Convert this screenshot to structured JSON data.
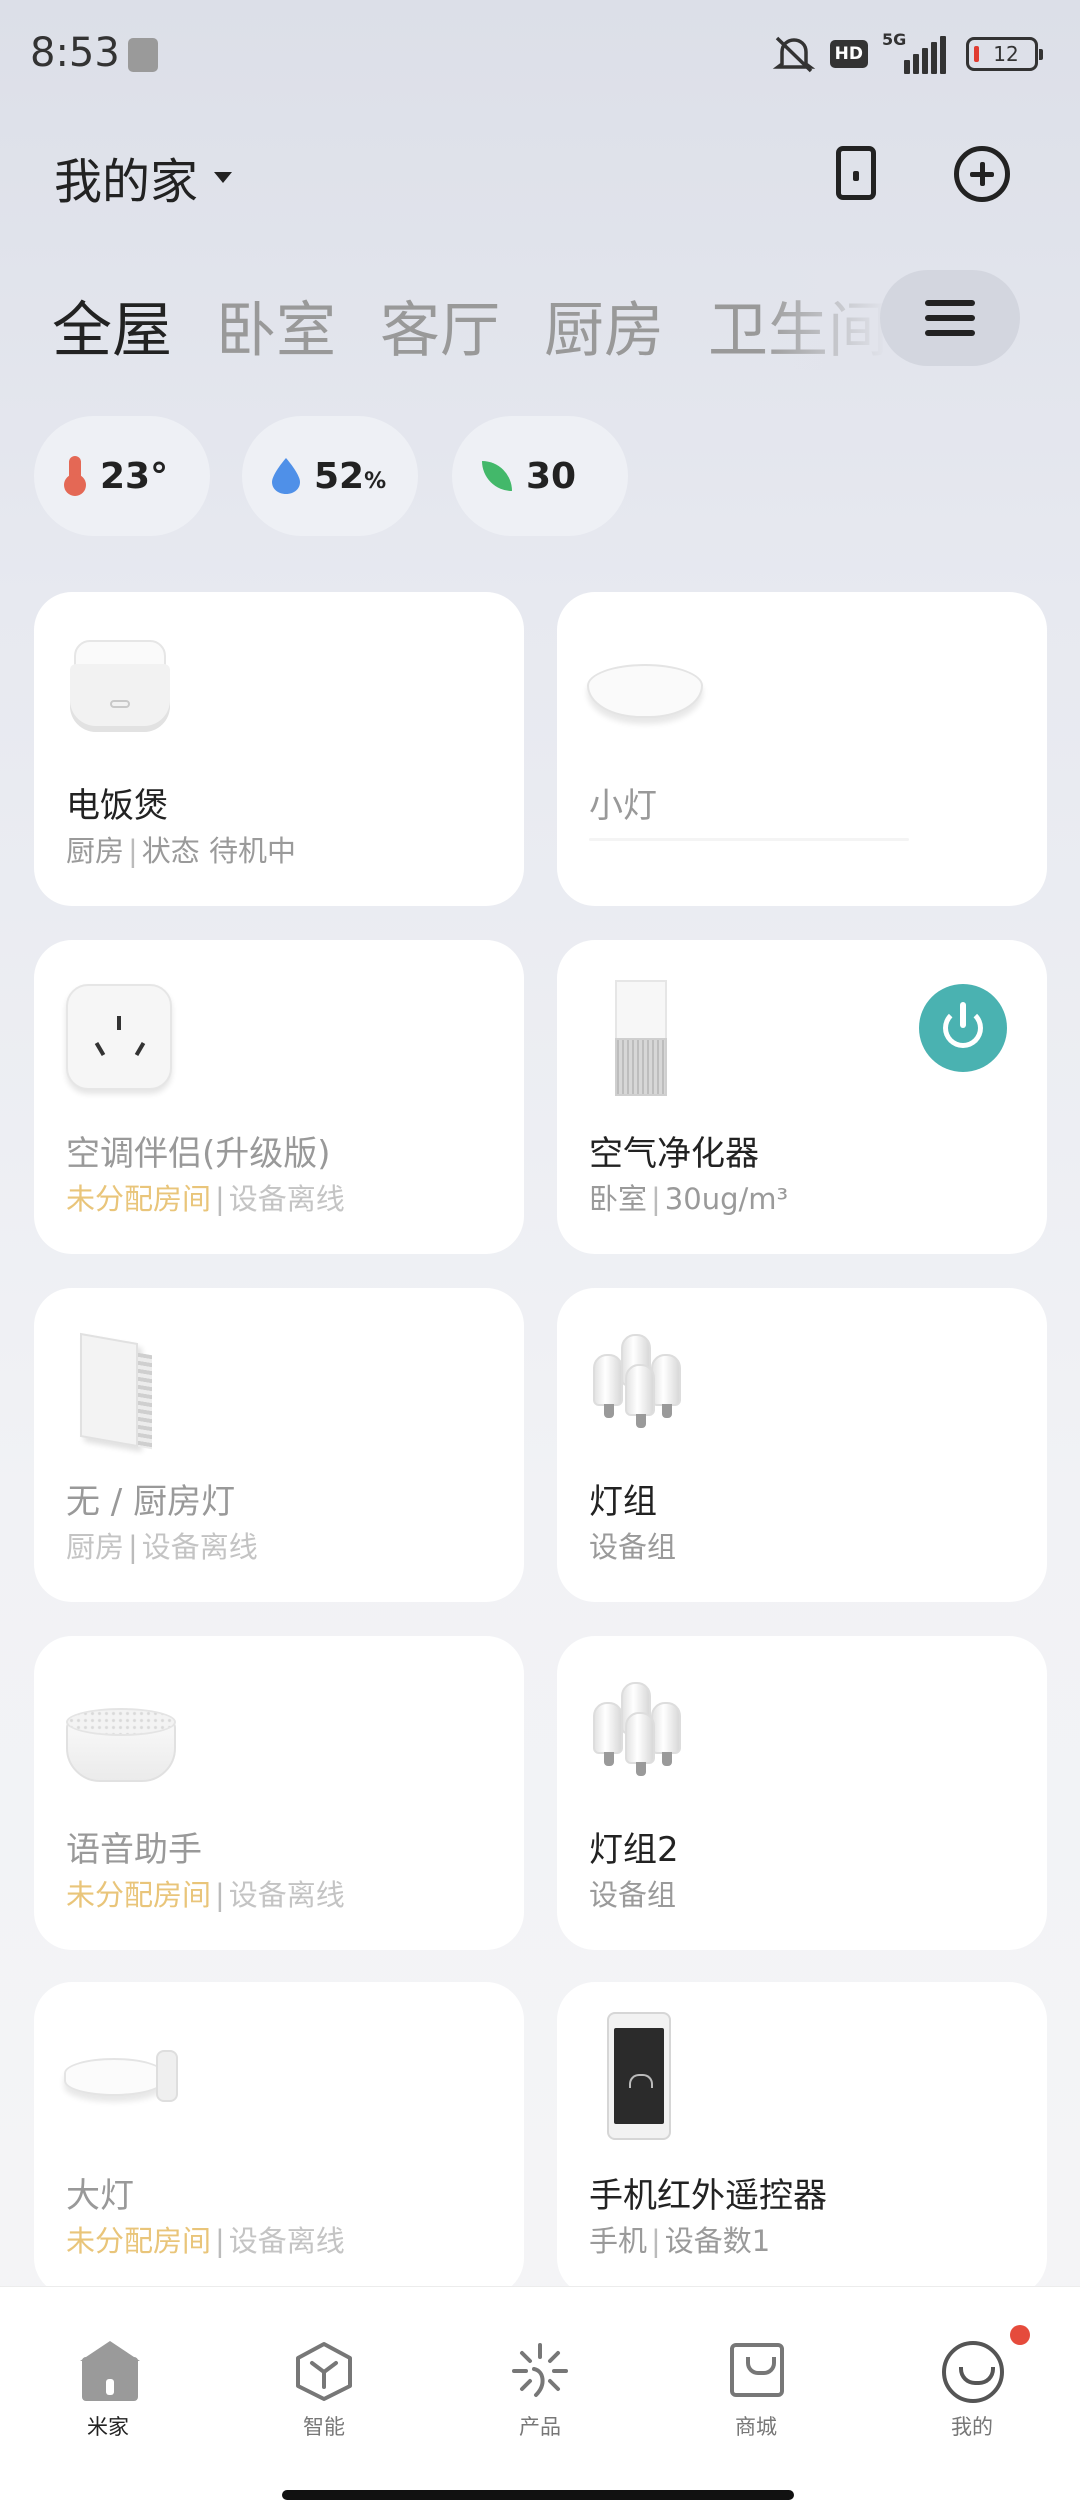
{
  "status_bar": {
    "time": "8:53",
    "hd_label": "HD",
    "network_label": "5G",
    "battery": "12"
  },
  "header": {
    "home_title": "我的家"
  },
  "rooms": {
    "tabs": [
      "全屋",
      "卧室",
      "客厅",
      "厨房",
      "卫生间"
    ],
    "active_index": 0
  },
  "environment": {
    "temperature": "23°",
    "humidity_value": "52",
    "humidity_unit": "%",
    "air_quality": "30"
  },
  "devices": [
    {
      "name": "电饭煲",
      "room": "厨房",
      "separator": "|",
      "status": "状态 待机中",
      "online": true,
      "image_icon": "rice-cooker-icon"
    },
    {
      "name": "小灯",
      "room": "",
      "separator": "",
      "status": "",
      "online": false,
      "image_icon": "ceiling-light-icon"
    },
    {
      "name": "空调伴侣(升级版)",
      "room": "未分配房间",
      "separator": "|",
      "status": "设备离线",
      "online": false,
      "image_icon": "ac-plug-icon"
    },
    {
      "name": "空气净化器",
      "room": "卧室",
      "separator": "|",
      "status": "30ug/m³",
      "online": true,
      "image_icon": "air-purifier-icon",
      "power_button": true
    },
    {
      "name": "无 / 厨房灯",
      "room": "厨房",
      "separator": "|",
      "status": "设备离线",
      "online": false,
      "image_icon": "wall-switch-icon"
    },
    {
      "name": "灯组",
      "room": "设备组",
      "separator": "",
      "status": "",
      "online": true,
      "image_icon": "bulb-group-icon"
    },
    {
      "name": "语音助手",
      "room": "未分配房间",
      "separator": "|",
      "status": "设备离线",
      "online": false,
      "image_icon": "smart-speaker-icon"
    },
    {
      "name": "灯组2",
      "room": "设备组",
      "separator": "",
      "status": "",
      "online": true,
      "image_icon": "bulb-group-icon"
    },
    {
      "name": "大灯",
      "room": "未分配房间",
      "separator": "|",
      "status": "设备离线",
      "online": false,
      "image_icon": "lamp-icon"
    },
    {
      "name": "手机红外遥控器",
      "room": "手机",
      "separator": "|",
      "status": "设备数1",
      "online": true,
      "image_icon": "phone-remote-icon"
    }
  ],
  "bottom_nav": {
    "items": [
      "米家",
      "智能",
      "产品",
      "商城",
      "我的"
    ],
    "active_index": 0
  },
  "colors": {
    "accent_teal": "#4ab2b1",
    "unassigned_yellow": "#e9c57a",
    "badge_red": "#e54b3c"
  }
}
